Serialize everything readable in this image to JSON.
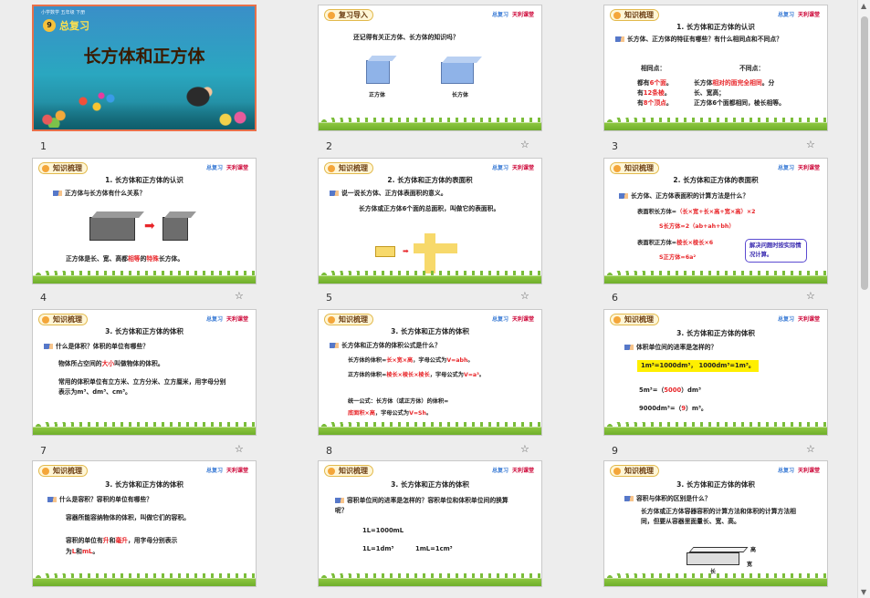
{
  "slides": [
    {
      "num": "1",
      "top_label": "小学数学 五年级 下册",
      "unit": "总复习",
      "unit_num": "9",
      "title": "长方体和正方体"
    },
    {
      "num": "2",
      "header": "复习导入",
      "brand_a": "总复习",
      "brand_b": "天利课堂",
      "question": "还记得有关正方体、长方体的知识吗？",
      "label_cube": "正方体",
      "label_cuboid": "长方体"
    },
    {
      "num": "3",
      "header": "知识梳理",
      "brand_a": "总复习",
      "brand_b": "天利课堂",
      "title": "1. 长方体和正方体的认识",
      "q": "长方体、正方体的特征有哪些？有什么相同点和不同点？",
      "same": "相同点：",
      "diff": "不同点：",
      "l1a": "都有",
      "l1b": "6个面",
      "l1c": "。",
      "l2a": "有",
      "l2b": "12条棱",
      "l2c": "。",
      "l3a": "有",
      "l3b": "8个顶点",
      "l3c": "。",
      "r1a": "长方体",
      "r1b": "相对的面完全相同",
      "r1c": "。分",
      "r2": "长、宽高；",
      "r3": "正方体6个面都相同，棱长相等。"
    },
    {
      "num": "4",
      "header": "知识梳理",
      "brand_a": "总复习",
      "brand_b": "天利课堂",
      "title": "1. 长方体和正方体的认识",
      "q": "正方体与长方体有什么关系？",
      "ans_a": "正方体是长、宽、高都",
      "ans_b": "相等",
      "ans_c": "的",
      "ans_d": "特殊",
      "ans_e": "长方体。"
    },
    {
      "num": "5",
      "header": "知识梳理",
      "brand_a": "总复习",
      "brand_b": "天利课堂",
      "title": "2. 长方体和正方体的表面积",
      "q": "说一说长方体、正方体表面积的意义。",
      "ans": "长方体或正方体6个面的总面积，叫做它的表面积。"
    },
    {
      "num": "6",
      "header": "知识梳理",
      "brand_a": "总复习",
      "brand_b": "天利课堂",
      "title": "2. 长方体和正方体的表面积",
      "q": "长方体、正方体表面积的计算方法是什么？",
      "f1a": "表面积长方体=",
      "f1b": "（长×宽+长×高+宽×高）×2",
      "f2": "S长方体=2（ab+ah+bh）",
      "f3a": "表面积正方体=",
      "f3b": "棱长×棱长×6",
      "f4": "S正方体=6a²",
      "note": "解决问题时按实际情况计算。"
    },
    {
      "num": "7",
      "header": "知识梳理",
      "brand_a": "总复习",
      "brand_b": "天利课堂",
      "title": "3. 长方体和正方体的体积",
      "q": "什么是体积？体积的单位有哪些？",
      "a1a": "物体所占空间的",
      "a1b": "大小",
      "a1c": "叫做物体的体积。",
      "a2": "常用的体积单位有立方米、立方分米、立方厘米，用字母分别表示为m³、dm³、cm³。"
    },
    {
      "num": "8",
      "header": "知识梳理",
      "brand_a": "总复习",
      "brand_b": "天利课堂",
      "title": "3. 长方体和正方体的体积",
      "q": "长方体和正方体的体积公式是什么？",
      "a1a": "长方体的体积=",
      "a1b": "长×宽×高",
      "a1c": "，字母公式为",
      "a1d": "V=abh",
      "a1e": "。",
      "a2a": "正方体的体积=",
      "a2b": "棱长×棱长×棱长",
      "a2c": "，字母公式为",
      "a2d": "V=a³",
      "a2e": "。",
      "a3": "统一公式：长方体（或正方体）的体积=",
      "a4a": "底面积×高",
      "a4b": "，字母公式为",
      "a4c": "V=Sh",
      "a4d": "。"
    },
    {
      "num": "9",
      "header": "知识梳理",
      "brand_a": "总复习",
      "brand_b": "天利课堂",
      "title": "3. 长方体和正方体的体积",
      "q": "体积单位间的进率是怎样的？",
      "hl": "1m³=1000dm³， 1000dm³=1m³。",
      "e1a": "5m³=（",
      "e1b": "5000",
      "e1c": "）dm³",
      "e2a": "9000dm³=（",
      "e2b": "9",
      "e2c": "）m³。"
    },
    {
      "num": "10",
      "header": "知识梳理",
      "brand_a": "总复习",
      "brand_b": "天利课堂",
      "title": "3. 长方体和正方体的体积",
      "q": "什么是容积？容积的单位有哪些？",
      "a1": "容器所能容纳物体的体积，叫做它们的容积。",
      "a2a": "容积的单位有",
      "a2b": "升",
      "a2c": "和",
      "a2d": "毫升",
      "a2e": "，用字母分别表示",
      "a3a": "为",
      "a3b": "L",
      "a3c": "和",
      "a3d": "mL",
      "a3e": "。"
    },
    {
      "num": "11",
      "header": "知识梳理",
      "brand_a": "总复习",
      "brand_b": "天利课堂",
      "title": "3. 长方体和正方体的体积",
      "q": "容积单位间的进率是怎样的？容积单位和体积单位间的换算呢？",
      "a1": "1L=1000mL",
      "a2": "1L=1dm³",
      "a3": "1mL=1cm³"
    },
    {
      "num": "12",
      "header": "知识梳理",
      "brand_a": "总复习",
      "brand_b": "天利课堂",
      "title": "3. 长方体和正方体的体积",
      "q": "容积与体积的区别是什么？",
      "a1": "长方体或正方体容器容积的计算方法和体积的计算方法相同，但要从容器里面量长、宽、高。",
      "l_h": "高",
      "l_w": "宽",
      "l_l": "长"
    }
  ]
}
